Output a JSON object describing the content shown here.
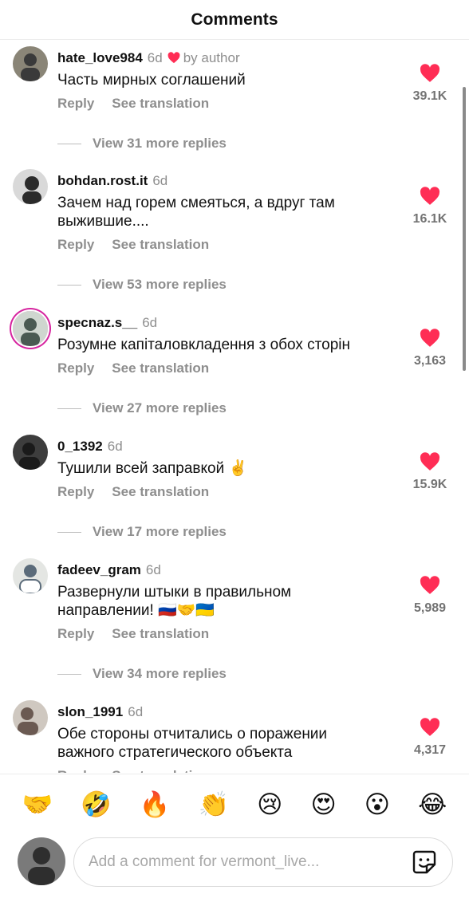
{
  "header": {
    "title": "Comments"
  },
  "by_author_label": "by author",
  "reply_label": "Reply",
  "see_translation_label": "See translation",
  "comments": [
    {
      "username": "hate_love984",
      "time": "6d",
      "liked_by_author": true,
      "text": "Часть мирных соглашений",
      "likes": "39.1K",
      "view_replies": "View 31 more replies",
      "avatar_colors": [
        "#8a8577",
        "#3a3a3a"
      ]
    },
    {
      "username": "bohdan.rost.it",
      "time": "6d",
      "text": "Зачем над горем смеяться, а вдруг там выжившие....",
      "likes": "16.1K",
      "view_replies": "View 53 more replies",
      "avatar_colors": [
        "#d9d9d9",
        "#2b2b2b"
      ]
    },
    {
      "username": "specnaz.s__",
      "time": "6d",
      "story_ring": true,
      "text": "Розумне капіталовкладення з обох сторін",
      "likes": "3,163",
      "view_replies": "View 27 more replies",
      "avatar_colors": [
        "#cfd6cf",
        "#4a5a52"
      ]
    },
    {
      "username": "0_1392",
      "time": "6d",
      "text": "Тушили всей заправкой ✌️",
      "likes": "15.9K",
      "view_replies": "View 17 more replies",
      "avatar_colors": [
        "#3d3d3d",
        "#1a1a1a"
      ]
    },
    {
      "username": "fadeev_gram",
      "time": "6d",
      "text": "Развернули штыки в правильном направлении! 🇷🇺🤝🇺🇦",
      "likes": "5,989",
      "view_replies": "View 34 more replies",
      "avatar_colors": [
        "#e4e6e3",
        "#5b6b7a"
      ]
    },
    {
      "username": "slon_1991",
      "time": "6d",
      "text": "Обе стороны отчитались о поражении важного стратегического объекта",
      "likes": "4,317",
      "avatar_colors": [
        "#cfc8c0",
        "#6b5a52"
      ]
    }
  ],
  "emoji_bar": [
    "🤝",
    "🤣",
    "🔥",
    "👏",
    "😢",
    "😍",
    "😮",
    "😂"
  ],
  "composer": {
    "placeholder": "Add a comment for vermont_live...",
    "value": "",
    "avatar_colors": [
      "#7a7a7a",
      "#2e2e2e"
    ]
  },
  "colors": {
    "heart": "#ff2d55",
    "muted_text": "#8e8e8e",
    "story_ring": "#d6249f"
  }
}
